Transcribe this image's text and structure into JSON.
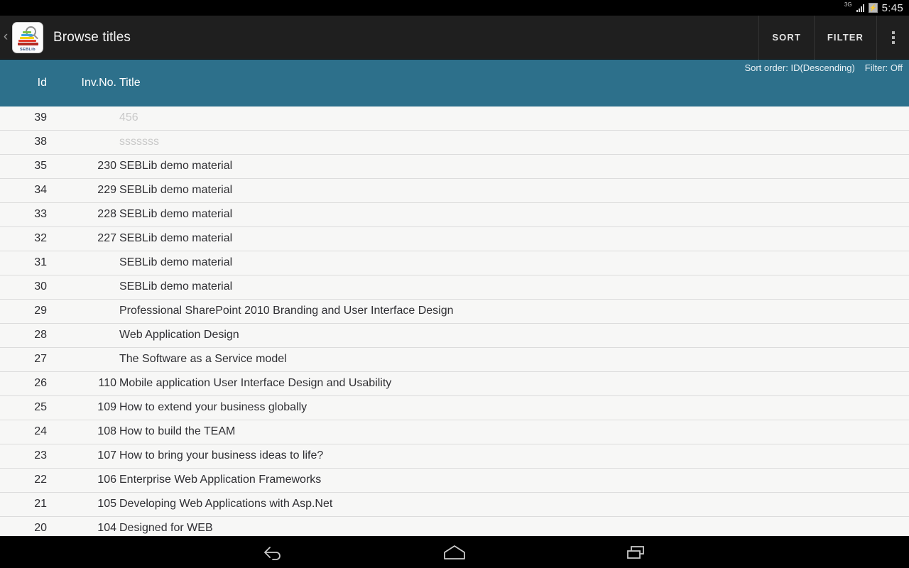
{
  "status_bar": {
    "network": "3G",
    "signal_icon": "signal-bars-icon",
    "battery_icon": "battery-charging-icon",
    "time": "5:45"
  },
  "action_bar": {
    "up_chevron": "‹",
    "app_icon_name": "seblib-app-icon",
    "app_icon_label": "SEBLib",
    "title": "Browse titles",
    "sort_label": "SORT",
    "filter_label": "FILTER",
    "overflow_label": "overflow-menu"
  },
  "info_bar": {
    "sort_order": "Sort order: ID(Descending)",
    "filter_state": "Filter: Off",
    "background_color": "#2d708b"
  },
  "table": {
    "columns": [
      "Id",
      "Inv.No.",
      "Title"
    ],
    "rows": [
      {
        "id": "39",
        "inv_no": "",
        "title": "456",
        "muted": true
      },
      {
        "id": "38",
        "inv_no": "",
        "title": "sssssss",
        "muted": true
      },
      {
        "id": "35",
        "inv_no": "230",
        "title": "SEBLib demo material",
        "muted": false
      },
      {
        "id": "34",
        "inv_no": "229",
        "title": "SEBLib demo material",
        "muted": false
      },
      {
        "id": "33",
        "inv_no": "228",
        "title": "SEBLib demo material",
        "muted": false
      },
      {
        "id": "32",
        "inv_no": "227",
        "title": "SEBLib demo material",
        "muted": false
      },
      {
        "id": "31",
        "inv_no": "",
        "title": "SEBLib demo material",
        "muted": false
      },
      {
        "id": "30",
        "inv_no": "",
        "title": "SEBLib demo material",
        "muted": false
      },
      {
        "id": "29",
        "inv_no": "",
        "title": "Professional SharePoint 2010 Branding and User Interface Design",
        "muted": false
      },
      {
        "id": "28",
        "inv_no": "",
        "title": "Web Application Design",
        "muted": false
      },
      {
        "id": "27",
        "inv_no": "",
        "title": "The Software as a Service model",
        "muted": false
      },
      {
        "id": "26",
        "inv_no": "110",
        "title": "Mobile application User Interface Design and Usability",
        "muted": false
      },
      {
        "id": "25",
        "inv_no": "109",
        "title": "How to extend your business globally",
        "muted": false
      },
      {
        "id": "24",
        "inv_no": "108",
        "title": "How to build the TEAM",
        "muted": false
      },
      {
        "id": "23",
        "inv_no": "107",
        "title": "How to bring your business ideas to life?",
        "muted": false
      },
      {
        "id": "22",
        "inv_no": "106",
        "title": "Enterprise Web Application Frameworks",
        "muted": false
      },
      {
        "id": "21",
        "inv_no": "105",
        "title": "Developing Web Applications with Asp.Net",
        "muted": false
      },
      {
        "id": "20",
        "inv_no": "104",
        "title": "Designed for WEB",
        "muted": false
      }
    ]
  },
  "nav_bar": {
    "back": "back-icon",
    "home": "home-icon",
    "recents": "recents-icon"
  }
}
